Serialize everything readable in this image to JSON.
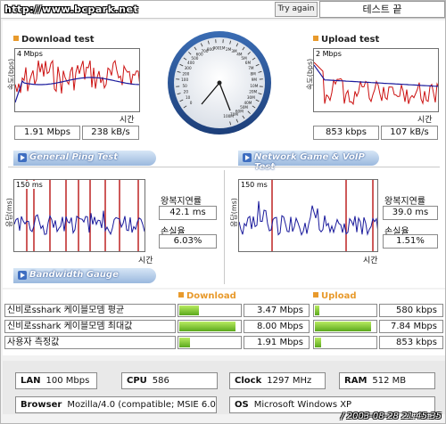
{
  "header": {
    "site_url": "http://www.bcpark.net",
    "try_again_label": "Try again",
    "test_end_label": "테스트 끝"
  },
  "download": {
    "title": "Download test",
    "scale_label": "4 Mbps",
    "y_label": "속도(bps)",
    "x_label": "시간",
    "speed_value": "1.91 Mbps",
    "bytes_value": "238 kB/s"
  },
  "upload": {
    "title": "Upload test",
    "scale_label": "2 Mbps",
    "y_label": "속도(bps)",
    "x_label": "시간",
    "speed_value": "853 kbps",
    "bytes_value": "107 kB/s"
  },
  "gauge": {
    "tick_labels": [
      "0",
      "10",
      "20",
      "50",
      "100",
      "200",
      "300",
      "400",
      "500",
      "600",
      "700",
      "800",
      "900",
      "1M",
      "2M",
      "3M",
      "4M",
      "5M",
      "6M",
      "7M",
      "8M",
      "9M",
      "10M",
      "20M",
      "30M",
      "40M",
      "50M",
      "60M",
      "70M",
      "100M"
    ]
  },
  "general_ping": {
    "banner_label": "General Ping Test",
    "scale_label": "150 ms",
    "y_label": "응답(ms)",
    "x_label": "시간",
    "rtt_label": "왕복지연률",
    "rtt_value": "42.1 ms",
    "loss_label": "손실율",
    "loss_value": "6.03%"
  },
  "game_ping": {
    "banner_label": "Network Game & VoIP Test",
    "scale_label": "150 ms",
    "y_label": "응답(ms)",
    "x_label": "시간",
    "rtt_label": "왕복지연률",
    "rtt_value": "39.0 ms",
    "loss_label": "손실율",
    "loss_value": "1.51%"
  },
  "bandwidth": {
    "banner_label": "Bandwidth Gauge",
    "download_header": "Download",
    "upload_header": "Upload",
    "rows": [
      {
        "label": "신비로sshark 케이블모뎀 평균",
        "download": "3.47 Mbps",
        "download_level": 0.33,
        "upload": "580 kbps",
        "upload_level": 0.07
      },
      {
        "label": "신비로sshark 케이블모뎀 최대값",
        "download": "8.00 Mbps",
        "download_level": 0.95,
        "upload": "7.84 Mbps",
        "upload_level": 0.95
      },
      {
        "label": "사용자 측정값",
        "download": "1.91 Mbps",
        "download_level": 0.18,
        "upload": "853 kbps",
        "upload_level": 0.11
      }
    ]
  },
  "system": {
    "lan_label": "LAN",
    "lan_value": "100 Mbps",
    "cpu_label": "CPU",
    "cpu_value": "586",
    "clock_label": "Clock",
    "clock_value": "1297 MHz",
    "ram_label": "RAM",
    "ram_value": "512 MB",
    "browser_label": "Browser",
    "browser_value": "Mozilla/4.0 (compatible; MSIE 6.0",
    "os_label": "OS",
    "os_value": "Microsoft Windows XP",
    "timestamp": "/ 2003-08-28 21:45:35"
  },
  "colors": {
    "accent_orange": "#e89a2c",
    "banner_blue": "#9ab8de",
    "graph_red": "#cc1111",
    "graph_navy": "#1a1a9c",
    "bar_green": "#6cc22a"
  }
}
